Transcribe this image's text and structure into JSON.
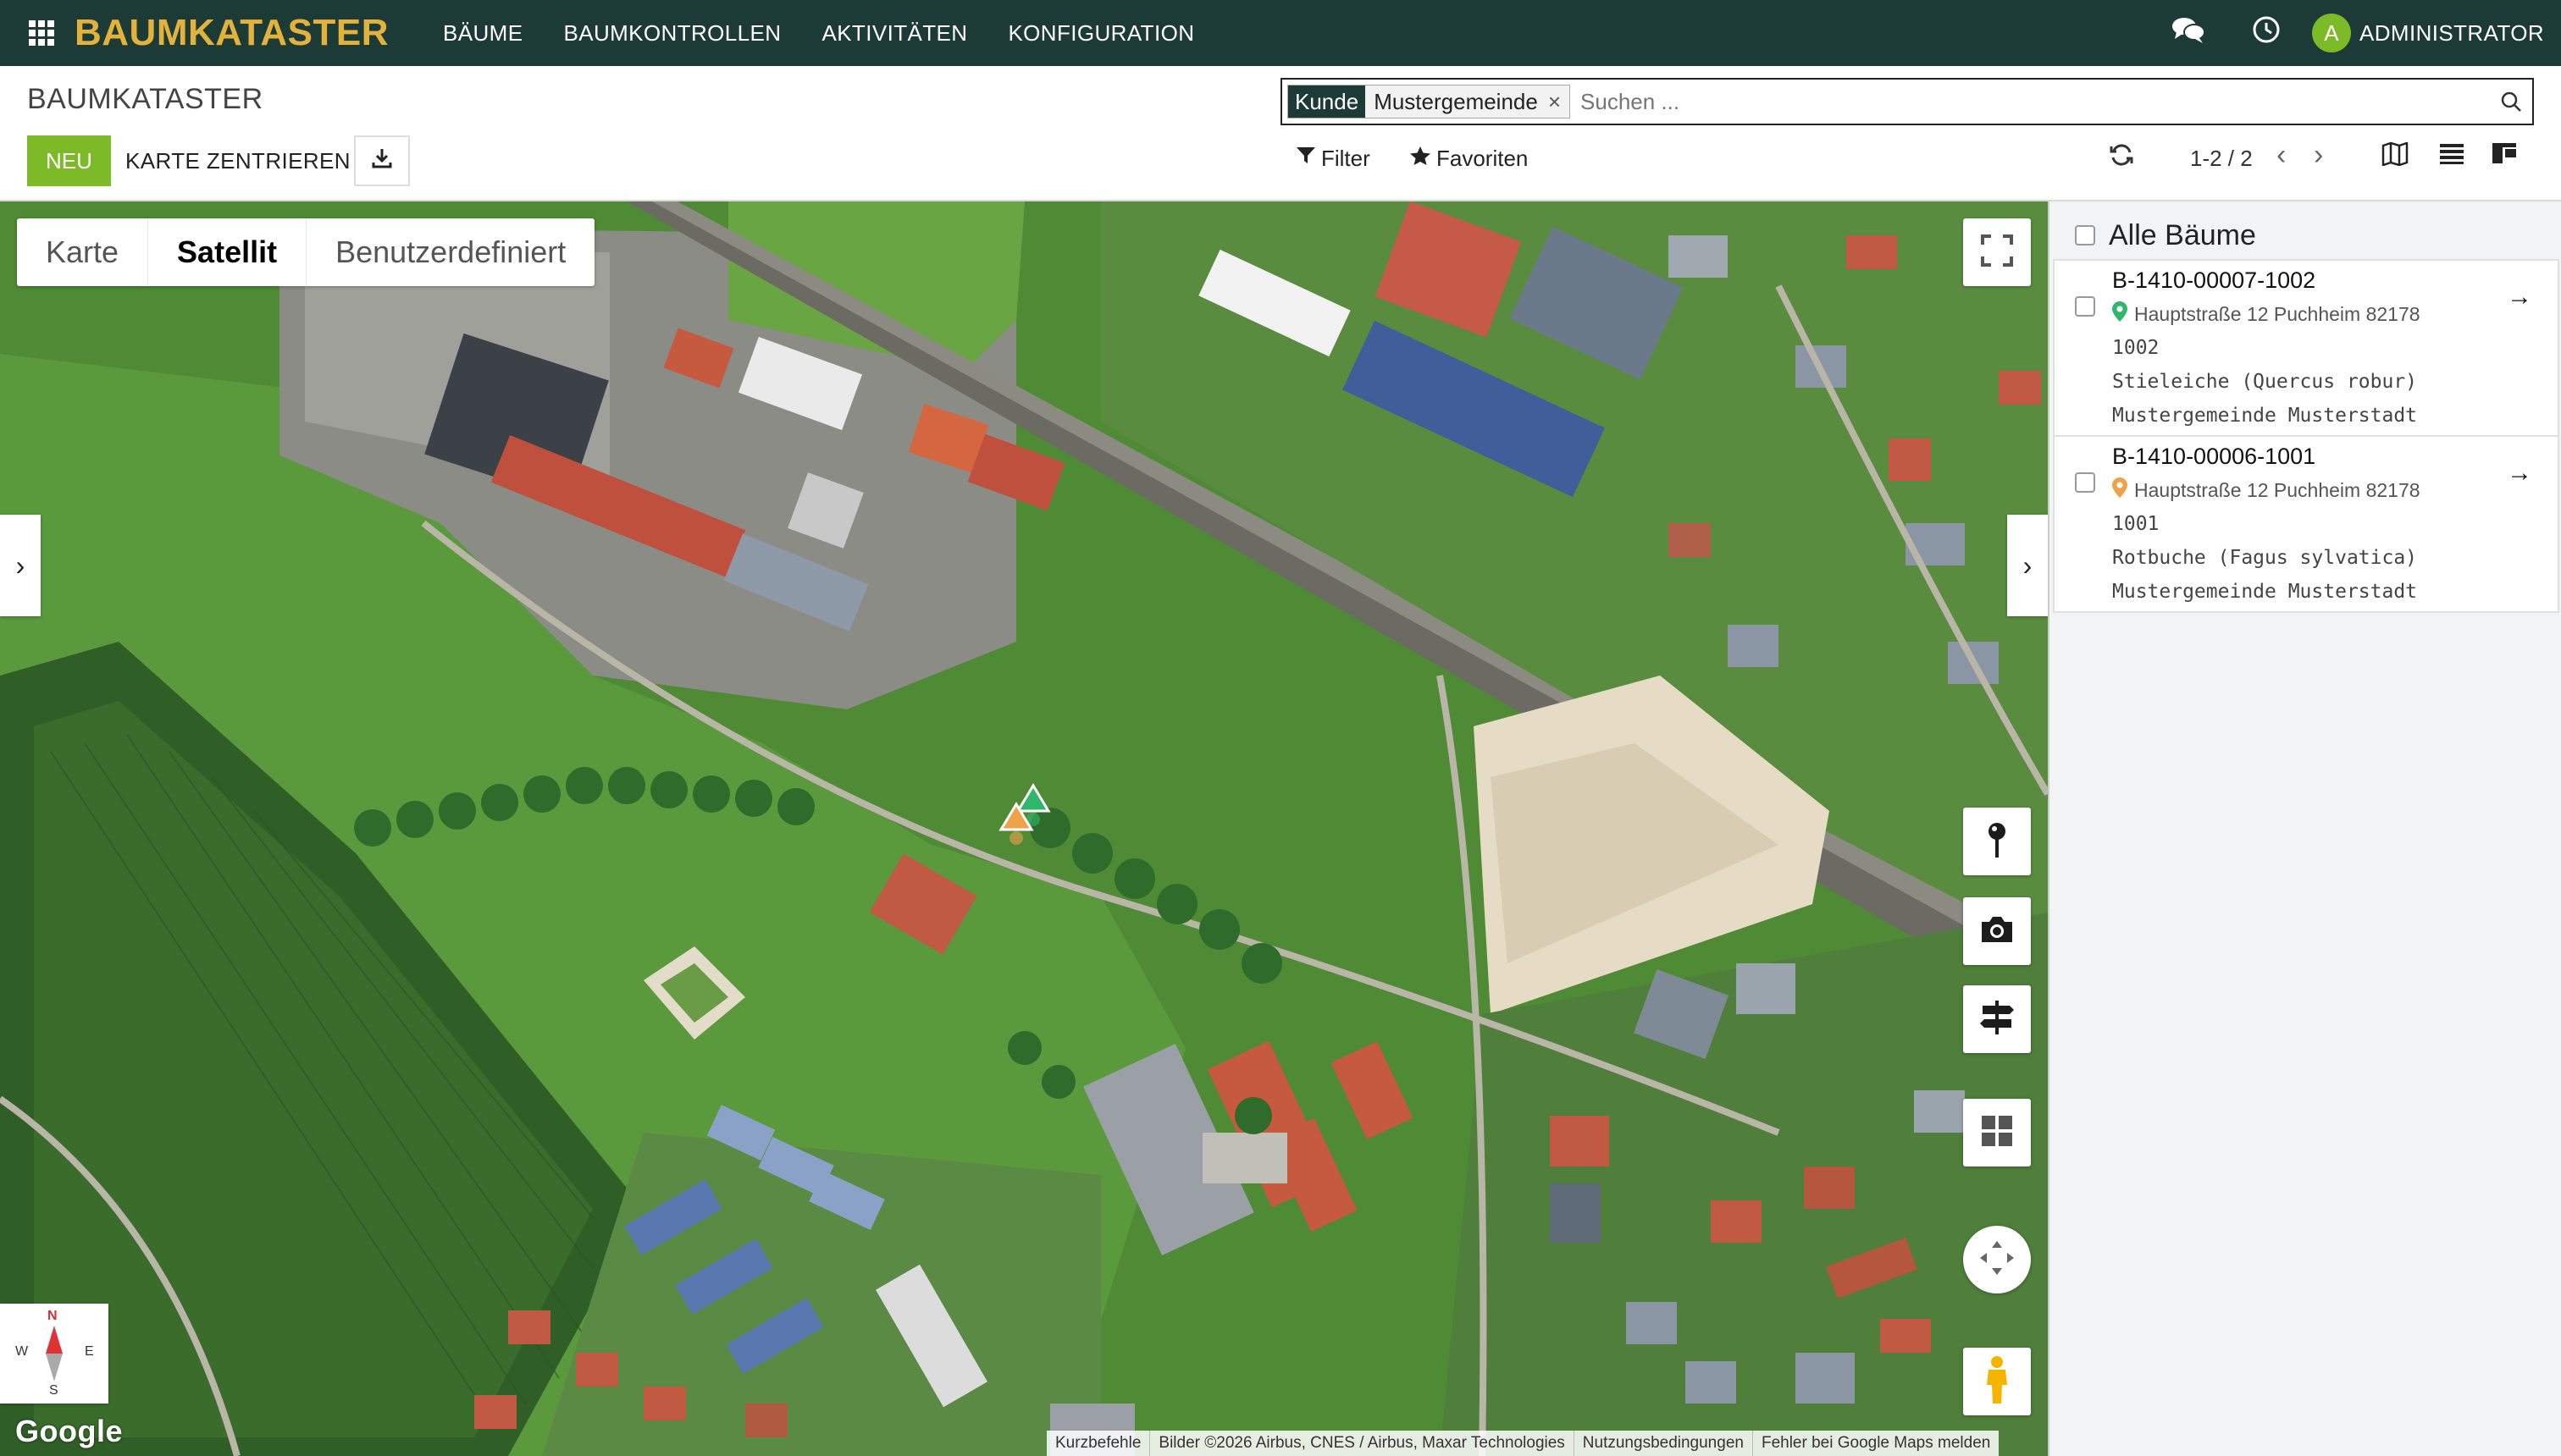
{
  "topnav": {
    "brand": "BAUMKATASTER",
    "menu": [
      "BÄUME",
      "BAUMKONTROLLEN",
      "AKTIVITÄTEN",
      "KONFIGURATION"
    ],
    "avatar_letter": "A",
    "user": "ADMINISTRATOR",
    "icons": [
      "apps-grid-icon",
      "chat-icon",
      "clock-icon"
    ]
  },
  "control": {
    "title": "BAUMKATASTER",
    "new_label": "NEU",
    "center_label": "KARTE ZENTRIEREN",
    "search": {
      "facet_key": "Kunde",
      "facet_value": "Mustergemeinde",
      "facet_remove": "×",
      "placeholder": "Suchen ...",
      "value": ""
    },
    "filter_label": "Filter",
    "favorites_label": "Favoriten",
    "pager": "1-2 / 2"
  },
  "map": {
    "types": [
      "Karte",
      "Satellit",
      "Benutzerdefiniert"
    ],
    "active_type": "Satellit",
    "compass": {
      "n": "N",
      "s": "S",
      "e": "E",
      "w": "W"
    },
    "google": "Google",
    "attribution": [
      "Kurzbefehle",
      "Bilder ©2026 Airbus, CNES / Airbus, Maxar Technologies",
      "Nutzungsbedingungen",
      "Fehler bei Google Maps melden"
    ],
    "marker_colors": {
      "tree_1002": "#2fb86b",
      "tree_1001": "#f0a24a"
    }
  },
  "sidebar": {
    "select_all_label": "Alle Bäume",
    "items": [
      {
        "name": "B-1410-00007-1002",
        "address": "Hauptstraße 12 Puchheim 82178",
        "number": "1002",
        "species": "Stieleiche (Quercus robur)",
        "owner": "Mustergemeinde Musterstadt",
        "pin_color": "#2fb86b"
      },
      {
        "name": "B-1410-00006-1001",
        "address": "Hauptstraße 12 Puchheim 82178",
        "number": "1001",
        "species": "Rotbuche (Fagus sylvatica)",
        "owner": "Mustergemeinde Musterstadt",
        "pin_color": "#f0a24a"
      }
    ]
  }
}
